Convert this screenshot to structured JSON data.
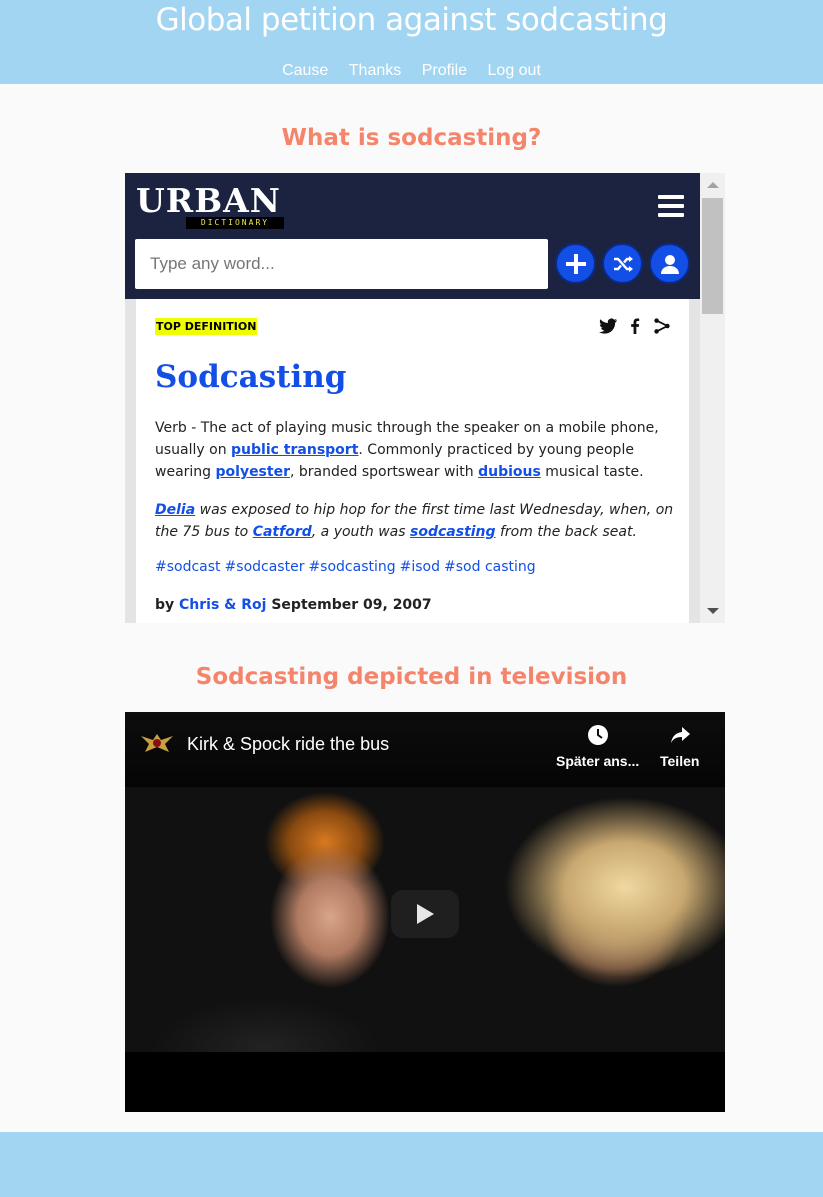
{
  "header": {
    "title": "Global petition against sodcasting",
    "nav": [
      "Cause",
      "Thanks",
      "Profile",
      "Log out"
    ]
  },
  "sections": {
    "what": "What is sodcasting?",
    "tv": "Sodcasting depicted in television"
  },
  "urban": {
    "logo_word": "URBAN",
    "logo_sub": "DICTIONARY",
    "search_placeholder": "Type any word...",
    "badge": "TOP DEFINITION",
    "word": "Sodcasting",
    "meaning": {
      "p1": "Verb - The act of playing music through the speaker on a mobile phone, usually on ",
      "l1": "public transport",
      "p2": ". Commonly practiced by young people wearing ",
      "l2": "polyester",
      "p3": ", branded sportswear with ",
      "l3": "dubious",
      "p4": " musical taste."
    },
    "example": {
      "l1": "Delia",
      "p1": " was exposed to hip hop for the first time last Wednesday, when, on the 75 bus to ",
      "l2": "Catford",
      "p2": ", a youth was ",
      "l3": "sodcasting",
      "p3": " from the back seat."
    },
    "tags": [
      "#sodcast",
      "#sodcaster",
      "#sodcasting",
      "#isod",
      "#sod casting"
    ],
    "author_prefix": "by ",
    "author": "Chris & Roj",
    "date": " September 09, 2007"
  },
  "video": {
    "title": "Kirk & Spock ride the bus",
    "watch_later": "Später ans...",
    "share": "Teilen"
  },
  "colors": {
    "header_bg": "#a2d5f2",
    "heading": "#f4846a",
    "ud_navy": "#1c2340",
    "ud_blue": "#134fe6"
  }
}
